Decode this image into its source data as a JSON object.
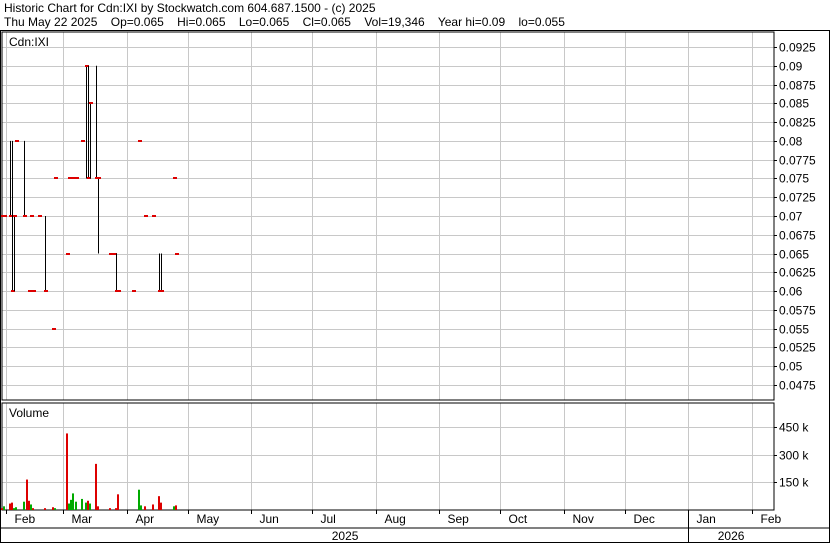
{
  "header": {
    "title": "Historic Chart for Cdn:IXI by Stockwatch.com 604.687.1500 - (c) 2025",
    "date": "Thu May 22 2025",
    "op": "Op=0.065",
    "hi": "Hi=0.065",
    "lo": "Lo=0.065",
    "cl": "Cl=0.065",
    "vol": "Vol=19,346",
    "yearhi": "Year hi=0.09",
    "yearlo": "lo=0.055"
  },
  "price_panel": {
    "label": "Cdn:IXI"
  },
  "volume_panel": {
    "label": "Volume"
  },
  "colors": {
    "up": "#00aa00",
    "down": "#dd0000",
    "close_tick": "#dd0000",
    "price_line": "#000000",
    "grid": "#c8c8c8",
    "frame": "#000000"
  },
  "chart_data": [
    {
      "type": "ohlc",
      "title": "Cdn:IXI",
      "ylim": [
        0.045,
        0.095
      ],
      "yticks": [
        "0.0475",
        "0.05",
        "0.0525",
        "0.055",
        "0.0575",
        "0.06",
        "0.0625",
        "0.065",
        "0.0675",
        "0.07",
        "0.0725",
        "0.075",
        "0.0775",
        "0.08",
        "0.0825",
        "0.085",
        "0.0875",
        "0.09",
        "0.0925"
      ],
      "grid": true,
      "bars": [
        {
          "date": "2025-01-30",
          "open": 0.07,
          "high": 0.07,
          "low": 0.07,
          "close": 0.07
        },
        {
          "date": "2025-01-31",
          "open": 0.07,
          "high": 0.07,
          "low": 0.07,
          "close": 0.07
        },
        {
          "date": "2025-02-03",
          "open": 0.07,
          "high": 0.08,
          "low": 0.07,
          "close": 0.07
        },
        {
          "date": "2025-02-04",
          "open": 0.06,
          "high": 0.08,
          "low": 0.06,
          "close": 0.06
        },
        {
          "date": "2025-02-05",
          "open": 0.06,
          "high": 0.07,
          "low": 0.06,
          "close": 0.07
        },
        {
          "date": "2025-02-06",
          "open": 0.08,
          "high": 0.08,
          "low": 0.08,
          "close": 0.08
        },
        {
          "date": "2025-02-10",
          "open": 0.07,
          "high": 0.08,
          "low": 0.07,
          "close": 0.07
        },
        {
          "date": "2025-02-12",
          "open": 0.06,
          "high": 0.06,
          "low": 0.06,
          "close": 0.06
        },
        {
          "date": "2025-02-13",
          "open": 0.07,
          "high": 0.07,
          "low": 0.07,
          "close": 0.07
        },
        {
          "date": "2025-02-14",
          "open": 0.06,
          "high": 0.06,
          "low": 0.06,
          "close": 0.06
        },
        {
          "date": "2025-02-17",
          "open": 0.07,
          "high": 0.07,
          "low": 0.07,
          "close": 0.07
        },
        {
          "date": "2025-02-20",
          "open": 0.07,
          "high": 0.07,
          "low": 0.06,
          "close": 0.06
        },
        {
          "date": "2025-02-24",
          "open": 0.055,
          "high": 0.055,
          "low": 0.055,
          "close": 0.055
        },
        {
          "date": "2025-02-25",
          "open": 0.075,
          "high": 0.075,
          "low": 0.075,
          "close": 0.075
        },
        {
          "date": "2025-03-03",
          "open": 0.065,
          "high": 0.065,
          "low": 0.065,
          "close": 0.065
        },
        {
          "date": "2025-03-04",
          "open": 0.075,
          "high": 0.075,
          "low": 0.075,
          "close": 0.075
        },
        {
          "date": "2025-03-05",
          "open": 0.075,
          "high": 0.075,
          "low": 0.075,
          "close": 0.075
        },
        {
          "date": "2025-03-06",
          "open": 0.075,
          "high": 0.075,
          "low": 0.075,
          "close": 0.075
        },
        {
          "date": "2025-03-07",
          "open": 0.075,
          "high": 0.075,
          "low": 0.075,
          "close": 0.075
        },
        {
          "date": "2025-03-10",
          "open": 0.08,
          "high": 0.08,
          "low": 0.08,
          "close": 0.08
        },
        {
          "date": "2025-03-12",
          "open": 0.09,
          "high": 0.09,
          "low": 0.075,
          "close": 0.09
        },
        {
          "date": "2025-03-13",
          "open": 0.09,
          "high": 0.09,
          "low": 0.075,
          "close": 0.075
        },
        {
          "date": "2025-03-14",
          "open": 0.085,
          "high": 0.085,
          "low": 0.075,
          "close": 0.085
        },
        {
          "date": "2025-03-17",
          "open": 0.075,
          "high": 0.09,
          "low": 0.075,
          "close": 0.075
        },
        {
          "date": "2025-03-18",
          "open": 0.075,
          "high": 0.075,
          "low": 0.065,
          "close": 0.075
        },
        {
          "date": "2025-03-24",
          "open": 0.065,
          "high": 0.065,
          "low": 0.065,
          "close": 0.065
        },
        {
          "date": "2025-03-26",
          "open": 0.065,
          "high": 0.065,
          "low": 0.065,
          "close": 0.065
        },
        {
          "date": "2025-03-27",
          "open": 0.06,
          "high": 0.065,
          "low": 0.06,
          "close": 0.06
        },
        {
          "date": "2025-03-28",
          "open": 0.06,
          "high": 0.06,
          "low": 0.06,
          "close": 0.06
        },
        {
          "date": "2025-04-04",
          "open": 0.06,
          "high": 0.06,
          "low": 0.06,
          "close": 0.06
        },
        {
          "date": "2025-04-07",
          "open": 0.08,
          "high": 0.08,
          "low": 0.08,
          "close": 0.08
        },
        {
          "date": "2025-04-10",
          "open": 0.07,
          "high": 0.07,
          "low": 0.07,
          "close": 0.07
        },
        {
          "date": "2025-04-14",
          "open": 0.07,
          "high": 0.07,
          "low": 0.07,
          "close": 0.07
        },
        {
          "date": "2025-04-17",
          "open": 0.065,
          "high": 0.065,
          "low": 0.06,
          "close": 0.06
        },
        {
          "date": "2025-04-18",
          "open": 0.06,
          "high": 0.065,
          "low": 0.06,
          "close": 0.06
        },
        {
          "date": "2025-04-24",
          "open": 0.075,
          "high": 0.075,
          "low": 0.075,
          "close": 0.075
        },
        {
          "date": "2025-04-25",
          "open": 0.065,
          "high": 0.065,
          "low": 0.065,
          "close": 0.065
        }
      ]
    },
    {
      "type": "bar",
      "title": "Volume",
      "ylim": [
        0,
        580000
      ],
      "yticks": [
        "150 k",
        "300 k",
        "450 k"
      ],
      "grid": true,
      "bars": [
        {
          "date": "2025-01-30",
          "value": 10000,
          "dir": "down"
        },
        {
          "date": "2025-01-31",
          "value": 20000,
          "dir": "up"
        },
        {
          "date": "2025-02-03",
          "value": 35000,
          "dir": "down"
        },
        {
          "date": "2025-02-04",
          "value": 40000,
          "dir": "down"
        },
        {
          "date": "2025-02-05",
          "value": 10000,
          "dir": "up"
        },
        {
          "date": "2025-02-06",
          "value": 15000,
          "dir": "up"
        },
        {
          "date": "2025-02-10",
          "value": 45000,
          "dir": "up"
        },
        {
          "date": "2025-02-11",
          "value": 165000,
          "dir": "down"
        },
        {
          "date": "2025-02-12",
          "value": 50000,
          "dir": "down"
        },
        {
          "date": "2025-02-13",
          "value": 30000,
          "dir": "up"
        },
        {
          "date": "2025-02-14",
          "value": 10000,
          "dir": "down"
        },
        {
          "date": "2025-02-20",
          "value": 10000,
          "dir": "down"
        },
        {
          "date": "2025-02-24",
          "value": 15000,
          "dir": "down"
        },
        {
          "date": "2025-02-25",
          "value": 10000,
          "dir": "up"
        },
        {
          "date": "2025-03-03",
          "value": 415000,
          "dir": "down"
        },
        {
          "date": "2025-03-04",
          "value": 35000,
          "dir": "up"
        },
        {
          "date": "2025-03-05",
          "value": 55000,
          "dir": "up"
        },
        {
          "date": "2025-03-06",
          "value": 90000,
          "dir": "up"
        },
        {
          "date": "2025-03-07",
          "value": 45000,
          "dir": "up"
        },
        {
          "date": "2025-03-10",
          "value": 60000,
          "dir": "up"
        },
        {
          "date": "2025-03-12",
          "value": 40000,
          "dir": "up"
        },
        {
          "date": "2025-03-13",
          "value": 50000,
          "dir": "down"
        },
        {
          "date": "2025-03-14",
          "value": 35000,
          "dir": "up"
        },
        {
          "date": "2025-03-17",
          "value": 250000,
          "dir": "down"
        },
        {
          "date": "2025-03-18",
          "value": 20000,
          "dir": "down"
        },
        {
          "date": "2025-03-24",
          "value": 10000,
          "dir": "down"
        },
        {
          "date": "2025-03-27",
          "value": 10000,
          "dir": "down"
        },
        {
          "date": "2025-03-28",
          "value": 85000,
          "dir": "down"
        },
        {
          "date": "2025-04-07",
          "value": 110000,
          "dir": "up"
        },
        {
          "date": "2025-04-08",
          "value": 25000,
          "dir": "up"
        },
        {
          "date": "2025-04-10",
          "value": 20000,
          "dir": "down"
        },
        {
          "date": "2025-04-14",
          "value": 30000,
          "dir": "down"
        },
        {
          "date": "2025-04-17",
          "value": 75000,
          "dir": "down"
        },
        {
          "date": "2025-04-18",
          "value": 40000,
          "dir": "down"
        },
        {
          "date": "2025-04-24",
          "value": 20000,
          "dir": "up"
        },
        {
          "date": "2025-04-25",
          "value": 25000,
          "dir": "down"
        }
      ]
    }
  ],
  "x_axis": {
    "months": [
      {
        "label": "Feb",
        "date": "2025-02-01"
      },
      {
        "label": "Mar",
        "date": "2025-03-01"
      },
      {
        "label": "Apr",
        "date": "2025-04-01"
      },
      {
        "label": "May",
        "date": "2025-05-01"
      },
      {
        "label": "Jun",
        "date": "2025-06-01"
      },
      {
        "label": "Jul",
        "date": "2025-07-01"
      },
      {
        "label": "Aug",
        "date": "2025-08-01"
      },
      {
        "label": "Sep",
        "date": "2025-09-01"
      },
      {
        "label": "Oct",
        "date": "2025-10-01"
      },
      {
        "label": "Nov",
        "date": "2025-11-01"
      },
      {
        "label": "Dec",
        "date": "2025-12-01"
      },
      {
        "label": "Jan",
        "date": "2026-01-01"
      },
      {
        "label": "Feb",
        "date": "2026-02-01"
      }
    ],
    "years": [
      {
        "label": "2025",
        "start": "2025-01-01",
        "end": "2026-01-01"
      },
      {
        "label": "2026",
        "start": "2026-01-01",
        "end": "2026-02-12"
      }
    ],
    "range": [
      "2025-01-30",
      "2026-02-12"
    ]
  }
}
